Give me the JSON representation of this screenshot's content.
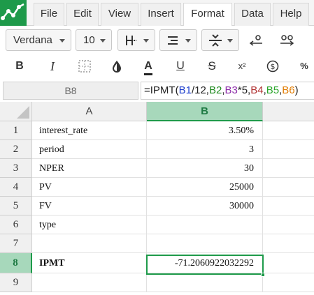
{
  "menu": {
    "items": [
      "File",
      "Edit",
      "View",
      "Insert",
      "Format",
      "Data",
      "Help"
    ],
    "active": "Format"
  },
  "toolbar": {
    "font": "Verdana",
    "font_size": "10",
    "bold": "B",
    "italic": "I",
    "text_color": "A",
    "underline": "U",
    "strike": "S",
    "superscript": "x²",
    "percent": "%"
  },
  "formula_bar": {
    "cell_ref": "B8",
    "formula_prefix": "=IPMT(",
    "formula_parts": [
      "B1",
      "/12,",
      "B2",
      ",",
      "B3",
      "*5,",
      "B4",
      ",",
      "B5",
      ",",
      "B6",
      ")"
    ]
  },
  "grid": {
    "columns": [
      "A",
      "B"
    ],
    "rows": [
      {
        "num": "1",
        "a": "interest_rate",
        "b": "3.50%"
      },
      {
        "num": "2",
        "a": "period",
        "b": "3"
      },
      {
        "num": "3",
        "a": "NPER",
        "b": "30"
      },
      {
        "num": "4",
        "a": "PV",
        "b": "25000"
      },
      {
        "num": "5",
        "a": "FV",
        "b": "30000"
      },
      {
        "num": "6",
        "a": "type",
        "b": ""
      },
      {
        "num": "7",
        "a": "",
        "b": ""
      },
      {
        "num": "8",
        "a": "IPMT",
        "b": "-71.2060922032292"
      },
      {
        "num": "9",
        "a": "",
        "b": ""
      }
    ],
    "selected_row": "8",
    "selected_col": "B"
  },
  "colors": {
    "accent": "#1e9a4a",
    "ref_b1": "#1a3ccc",
    "ref_b2": "#1e8a1e",
    "ref_b3": "#8b2aa8",
    "ref_b4": "#b03030",
    "ref_b5": "#2aa52a",
    "ref_b6": "#e07b00"
  }
}
